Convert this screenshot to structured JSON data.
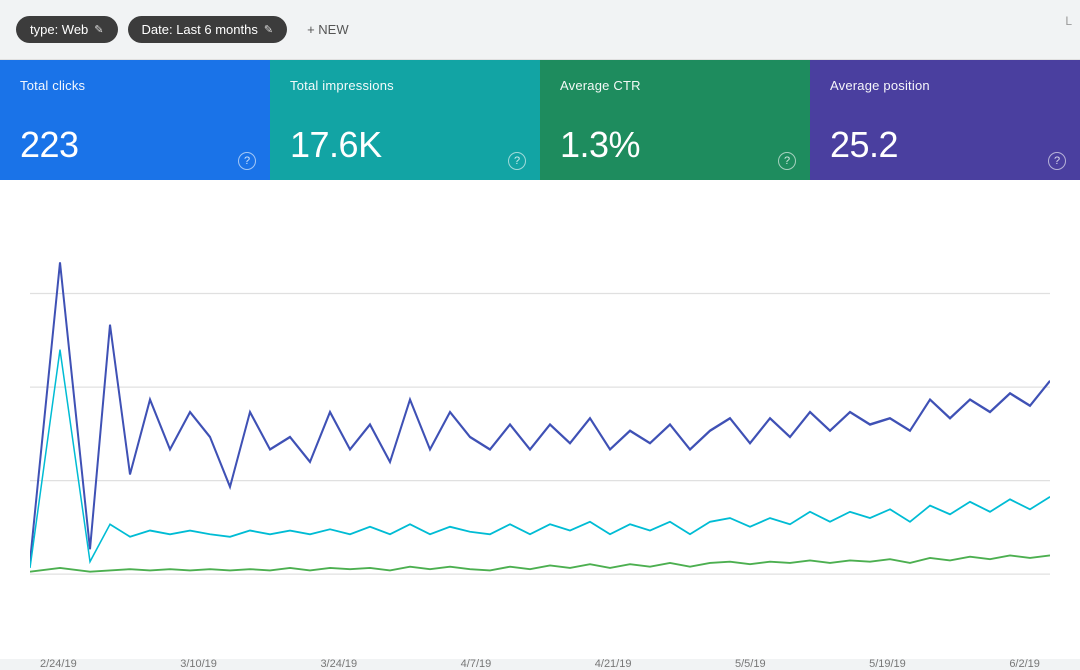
{
  "toolbar": {
    "filter_type_label": "type: Web",
    "filter_type_edit": "✎",
    "filter_date_label": "Date: Last 6 months",
    "filter_date_edit": "✎",
    "new_button_label": "+ NEW",
    "corner_text": "L"
  },
  "stats": [
    {
      "label": "Total clicks",
      "value": "223",
      "color": "#1a73e8"
    },
    {
      "label": "Total impressions",
      "value": "17.6K",
      "color": "#12a4a4"
    },
    {
      "label": "Average CTR",
      "value": "1.3%",
      "color": "#1e8c5e"
    },
    {
      "label": "Average position",
      "value": "25.2",
      "color": "#4a3f9f"
    }
  ],
  "chart": {
    "x_labels": [
      "2/24/19",
      "3/10/19",
      "3/24/19",
      "4/7/19",
      "4/21/19",
      "5/5/19",
      "5/19/19",
      "6/2/19"
    ],
    "colors": {
      "clicks": "#3366cc",
      "impressions": "#00bcd4",
      "ctr": "#4caf50"
    }
  }
}
